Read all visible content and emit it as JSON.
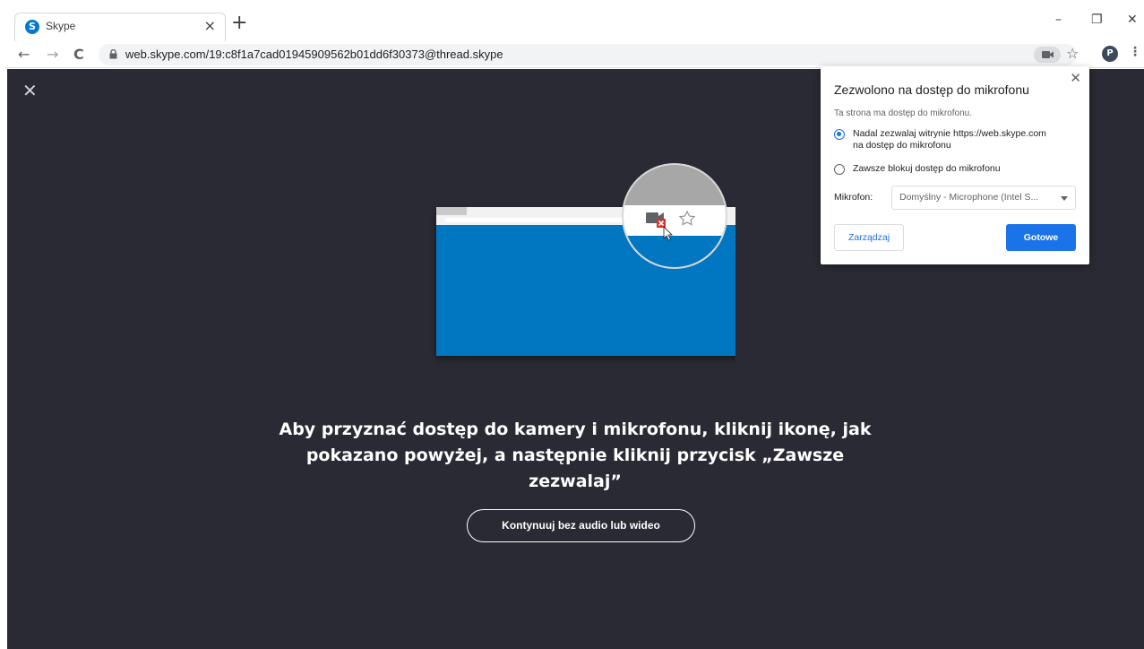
{
  "browser": {
    "tab": {
      "favicon_letter": "S",
      "title": "Skype",
      "close": "×"
    },
    "new_tab": "+",
    "window_controls": {
      "minimize": "–",
      "restore": "❐",
      "close": "✕"
    },
    "nav": {
      "back": "←",
      "forward": "→",
      "reload": "C"
    },
    "url": "web.skype.com/19:c8f1a7cad01945909562b01dd6f30373@thread.skype",
    "star": "☆",
    "profile_letter": "P",
    "menu": "⋮"
  },
  "content": {
    "close": "✕",
    "heading_line1": "Aby przyznać dostęp do kamery i mikrofonu, kliknij ikonę, jak",
    "heading_line2": "pokazano powyżej, a następnie kliknij przycisk „Zawsze",
    "heading_line3": "zezwalaj”",
    "continue_button": "Kontynuuj bez audio lub wideo"
  },
  "popup": {
    "close": "✕",
    "title": "Zezwolono na dostęp do mikrofonu",
    "subtitle": "Ta strona ma dostęp do mikrofonu.",
    "option_allow_line1": "Nadal zezwalaj witrynie https://web.skype.com",
    "option_allow_line2": "na dostęp do mikrofonu",
    "option_block": "Zawsze blokuj dostęp do mikrofonu",
    "selected_option": "allow",
    "mic_label": "Mikrofon:",
    "mic_value": "Domyślny - Microphone (Intel S...",
    "manage_button": "Zarządzaj",
    "done_button": "Gotowe"
  },
  "colors": {
    "content_bg": "#292a33",
    "illustration_blue": "#0077c0",
    "accent": "#1a73e8"
  }
}
